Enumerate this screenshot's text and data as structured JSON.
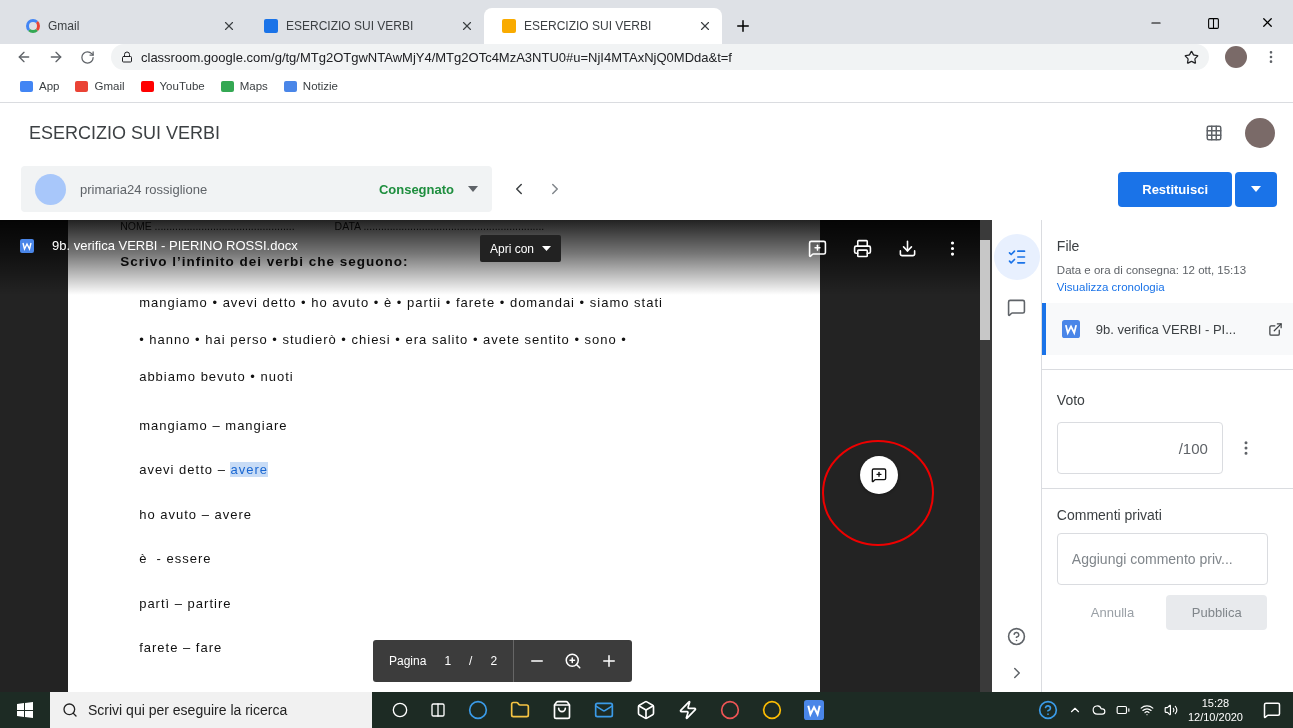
{
  "browser": {
    "tabs": [
      {
        "title": "Gmail",
        "selected": false
      },
      {
        "title": "ESERCIZIO SUI VERBI",
        "selected": false
      },
      {
        "title": "ESERCIZIO SUI VERBI",
        "selected": true
      }
    ],
    "url": "classroom.google.com/g/tg/MTg2OTgwNTAwMjY4/MTg2OTc4MzA3NTU0#u=NjI4MTAxNjQ0MDda&t=f",
    "bookmarks": [
      "App",
      "Gmail",
      "YouTube",
      "Maps",
      "Notizie"
    ]
  },
  "page": {
    "title": "ESERCIZIO SUI VERBI",
    "student": {
      "name": "primaria24 rossiglione",
      "status": "Consegnato"
    },
    "return_button": "Restituisci"
  },
  "viewer": {
    "file_name": "9b. verifica VERBI - PIERINO ROSSI.docx",
    "open_with": "Apri con",
    "document": {
      "header_fields": [
        "NOME ................................................",
        "DATA .............................................................."
      ],
      "heading": "Scrivo l’infinito dei verbi che seguono:",
      "exercise_lines": [
        "mangiamo • avevi detto • ho avuto • è • partii • farete • domandai • siamo stati",
        "• hanno •  hai perso • studierò • chiesi • era salito • avete sentito • sono •",
        "abbiamo bevuto • nuoti"
      ],
      "answers": [
        {
          "text": "mangiamo – mangiare"
        },
        {
          "text": "avevi detto – ",
          "selected_text": "avere"
        },
        {
          "text": "ho avuto – avere"
        },
        {
          "text": "è  - essere"
        },
        {
          "text": "partì – partire"
        },
        {
          "text": "farete – fare"
        }
      ]
    },
    "pager": {
      "label": "Pagina",
      "current": "1",
      "separator": "/",
      "total": "2"
    }
  },
  "panel": {
    "file": {
      "title": "File",
      "delivered": "Data e ora di consegna: 12 ott, 15:13",
      "history_link": "Visualizza cronologia",
      "attachment": "9b. verifica VERBI - PI..."
    },
    "grade": {
      "title": "Voto",
      "value": "/100"
    },
    "comments": {
      "title": "Commenti privati",
      "placeholder": "Aggiungi commento priv...",
      "cancel": "Annulla",
      "publish": "Pubblica"
    }
  },
  "taskbar": {
    "search_placeholder": "Scrivi qui per eseguire la ricerca",
    "time": "15:28",
    "date": "12/10/2020"
  }
}
